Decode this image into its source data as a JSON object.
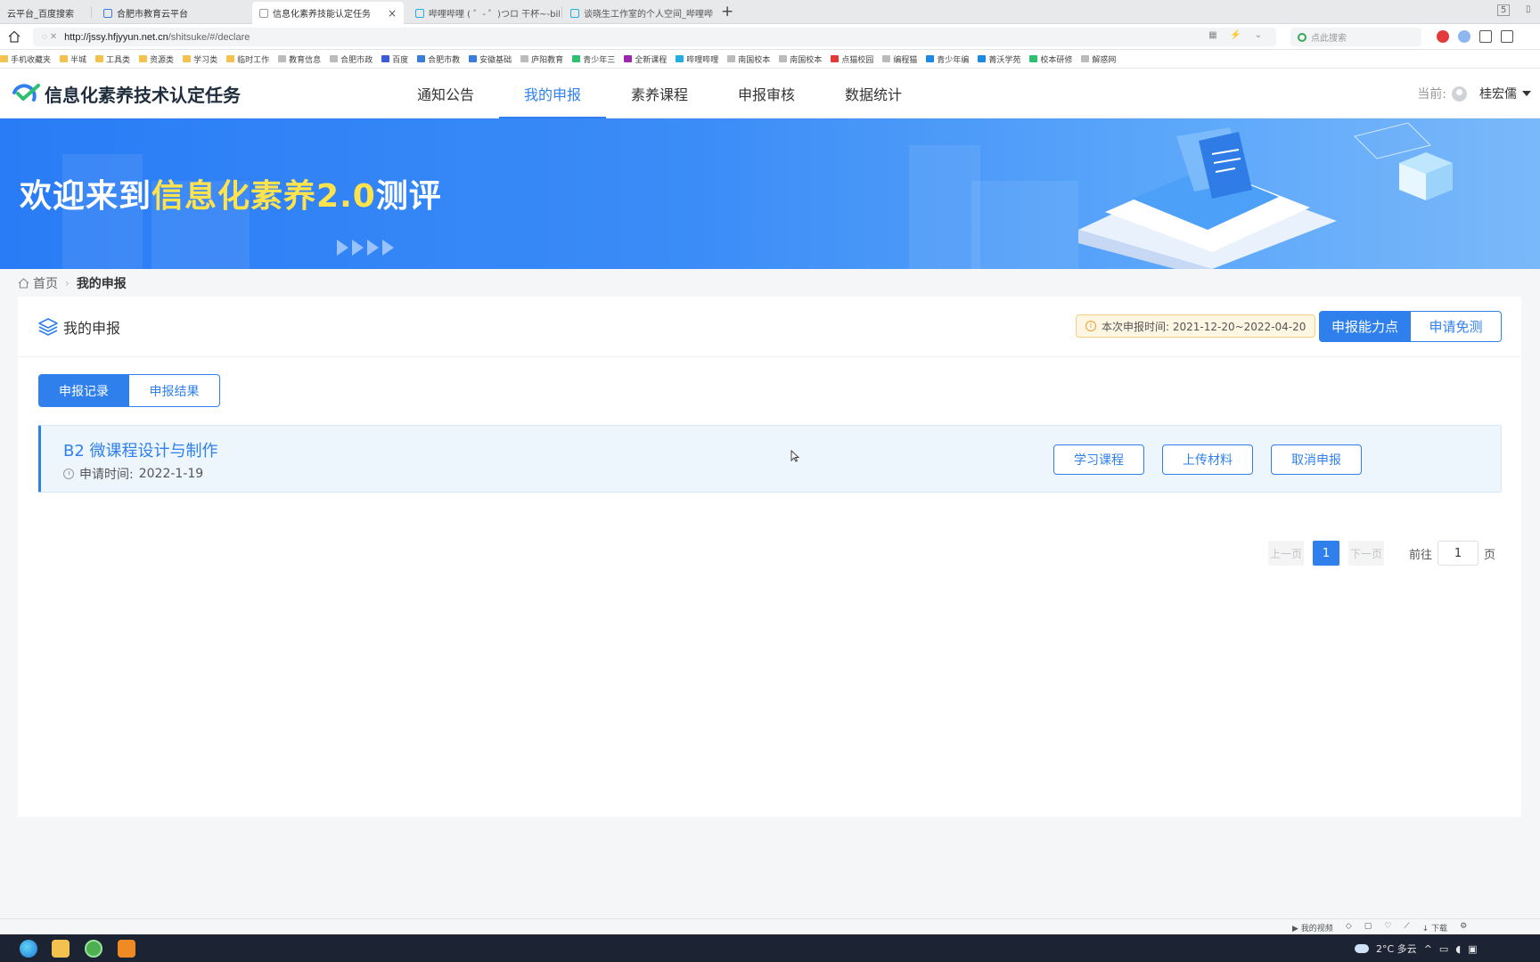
{
  "browser": {
    "tabs": [
      {
        "label": "云平台_百度搜索",
        "active": false
      },
      {
        "label": "合肥市教育云平台",
        "active": false
      },
      {
        "label": "信息化素养技能认定任务",
        "active": true
      },
      {
        "label": "哔哩哔哩 ( ゜- ゜)つロ 干杯~-bil",
        "active": false
      },
      {
        "label": "谈晓生工作室的个人空间_哔哩哔",
        "active": false
      }
    ],
    "tab_close": "×",
    "new_tab": "+",
    "tab_count": "5",
    "url_host": "http://jssy.hfjyyun.net.cn",
    "url_path": "/shitsuke/#/declare",
    "search_placeholder": "点此搜索",
    "bookmarks": [
      "手机收藏夹",
      "半城",
      "工具类",
      "资源类",
      "学习类",
      "临时工作",
      "教育信息",
      "合肥市政",
      "百度",
      "合肥市教",
      "安徽基础",
      "庐阳教育",
      "青少年三",
      "全新课程",
      "哔哩哔哩",
      "南国校本",
      "南国校本",
      "点猫校园",
      "编程猫",
      "青少年编",
      "菁沃学苑",
      "校本研修",
      "解惑网"
    ]
  },
  "header": {
    "logo_text": "信息化素养技术认定任务",
    "nav": [
      {
        "label": "通知公告",
        "active": false
      },
      {
        "label": "我的申报",
        "active": true
      },
      {
        "label": "素养课程",
        "active": false
      },
      {
        "label": "申报审核",
        "active": false
      },
      {
        "label": "数据统计",
        "active": false
      }
    ],
    "user_prefix": "当前:",
    "user_name": "桂宏儒"
  },
  "banner": {
    "title_prefix": "欢迎来到",
    "title_highlight": "信息化素养2.0",
    "title_suffix": "测评"
  },
  "breadcrumb": {
    "home": "首页",
    "current": "我的申报"
  },
  "panel": {
    "title": "我的申报",
    "notice": "本次申报时间: 2021-12-20~2022-04-20",
    "btn_declare": "申报能力点",
    "btn_exempt": "申请免测",
    "subtabs": [
      {
        "label": "申报记录",
        "active": true
      },
      {
        "label": "申报结果",
        "active": false
      }
    ],
    "record": {
      "title": "B2 微课程设计与制作",
      "time_label": "申请时间:",
      "time_value": "2022-1-19",
      "buttons": [
        "学习课程",
        "上传材料",
        "取消申报"
      ]
    },
    "pager": {
      "prev": "上一页",
      "current": "1",
      "next": "下一页",
      "goto_label": "前往",
      "goto_value": "1",
      "goto_unit": "页"
    }
  },
  "statusbar": {
    "video": "我的视频",
    "download": "下载"
  },
  "taskbar": {
    "weather": "2°C 多云"
  },
  "colors": {
    "accent": "#2f80ed",
    "banner_highlight": "#ffe34d"
  }
}
